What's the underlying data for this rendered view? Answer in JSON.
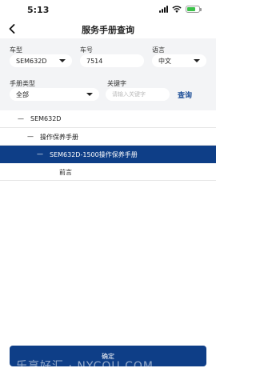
{
  "status": {
    "time": "5:13",
    "battery_level": 0.7
  },
  "header": {
    "title": "服务手册查询"
  },
  "filters": {
    "model": {
      "label": "车型",
      "value": "SEM632D"
    },
    "number": {
      "label": "车号",
      "value": "7514"
    },
    "language": {
      "label": "语言",
      "value": "中文"
    },
    "manual_type": {
      "label": "手册类型",
      "value": "全部"
    },
    "keyword": {
      "label": "关键字",
      "placeholder": "请输入关键字",
      "value": ""
    },
    "search_label": "查询"
  },
  "tree": [
    {
      "prefix": "—",
      "label": "SEM632D",
      "level": 0,
      "selected": false
    },
    {
      "prefix": "—",
      "label": "操作保养手册",
      "level": 1,
      "selected": false
    },
    {
      "prefix": "—",
      "label": "SEM632D-1500操作保养手册",
      "level": 2,
      "selected": true
    },
    {
      "prefix": "",
      "label": "前言",
      "level": 3,
      "selected": false
    }
  ],
  "footer": {
    "confirm_label": "确定",
    "watermark": "乐享好汇 · NYCOU.COM"
  },
  "colors": {
    "primary": "#0e3e87",
    "link": "#1d4e97",
    "panel": "#f3f4f6"
  }
}
